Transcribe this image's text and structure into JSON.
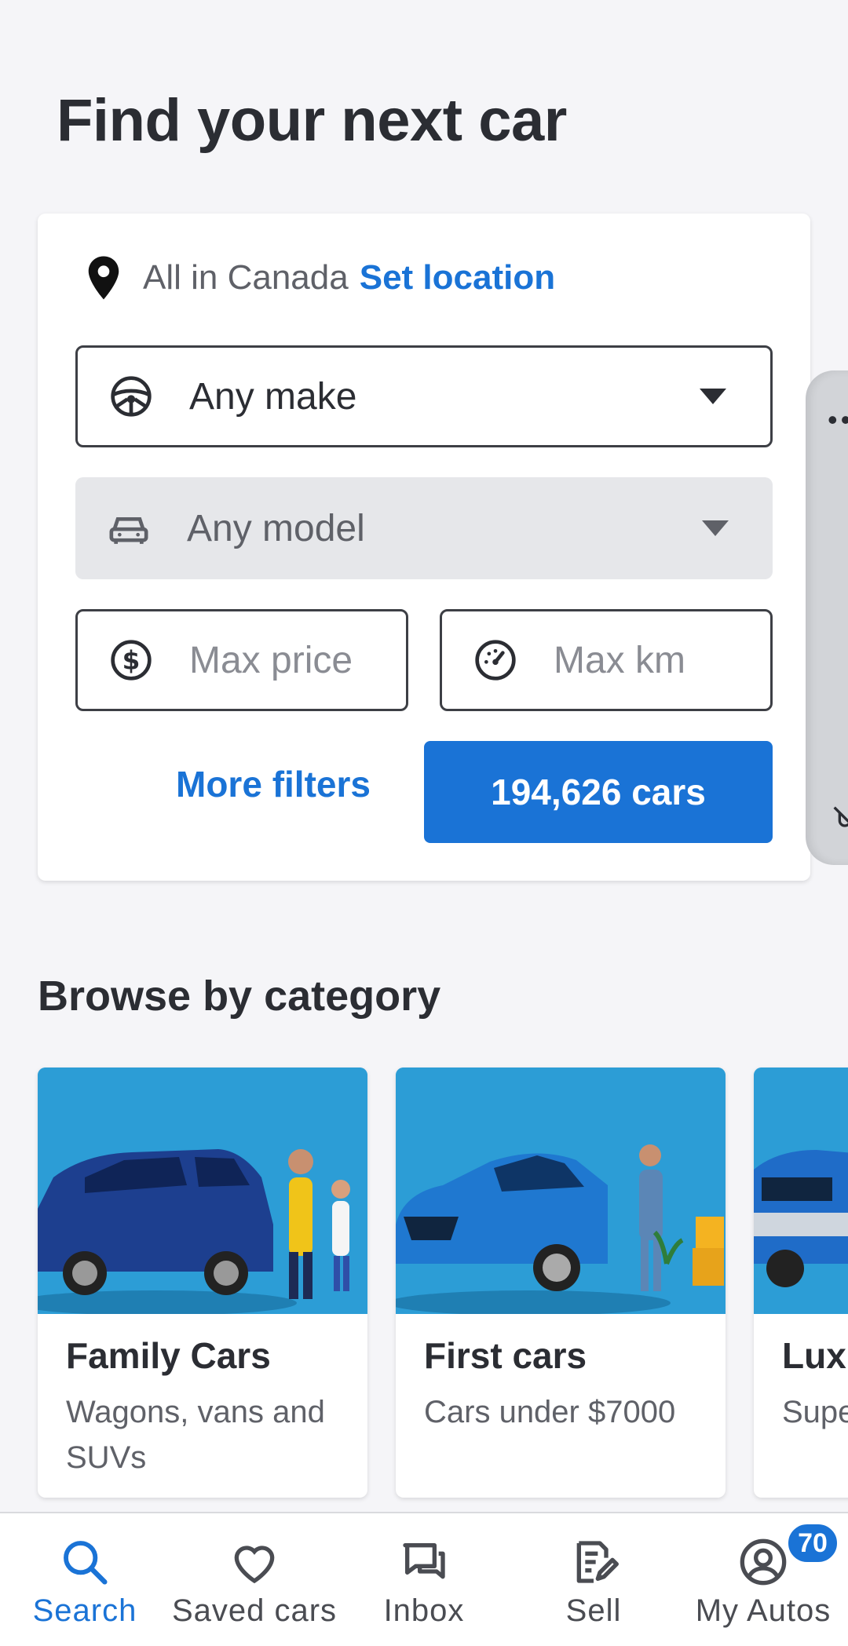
{
  "header": {
    "title": "Find your next car"
  },
  "search": {
    "location_text": "All in Canada",
    "location_link": "Set location",
    "make": {
      "icon": "steering-wheel-icon",
      "value": "Any make"
    },
    "model": {
      "icon": "car-icon",
      "value": "Any model",
      "disabled": true
    },
    "max_price": {
      "icon": "dollar-circle-icon",
      "placeholder": "Max price"
    },
    "max_km": {
      "icon": "speedometer-icon",
      "placeholder": "Max km"
    },
    "more_filters": "More filters",
    "results_button": "194,626 cars"
  },
  "browse": {
    "title": "Browse by category",
    "categories": [
      {
        "title": "Family Cars",
        "subtitle": "Wagons, vans and SUVs"
      },
      {
        "title": "First cars",
        "subtitle": "Cars under $7000"
      },
      {
        "title": "Luxu",
        "subtitle": "Supe and p"
      }
    ]
  },
  "bottom_nav": {
    "items": [
      {
        "label": "Search",
        "icon": "search-icon",
        "active": true
      },
      {
        "label": "Saved cars",
        "icon": "heart-icon"
      },
      {
        "label": "Inbox",
        "icon": "chat-icon"
      },
      {
        "label": "Sell",
        "icon": "edit-document-icon"
      },
      {
        "label": "My Autos",
        "icon": "account-icon",
        "badge": "70"
      }
    ]
  },
  "colors": {
    "accent": "#1a73d6",
    "text": "#2b2d33",
    "background": "#f5f5f8"
  }
}
